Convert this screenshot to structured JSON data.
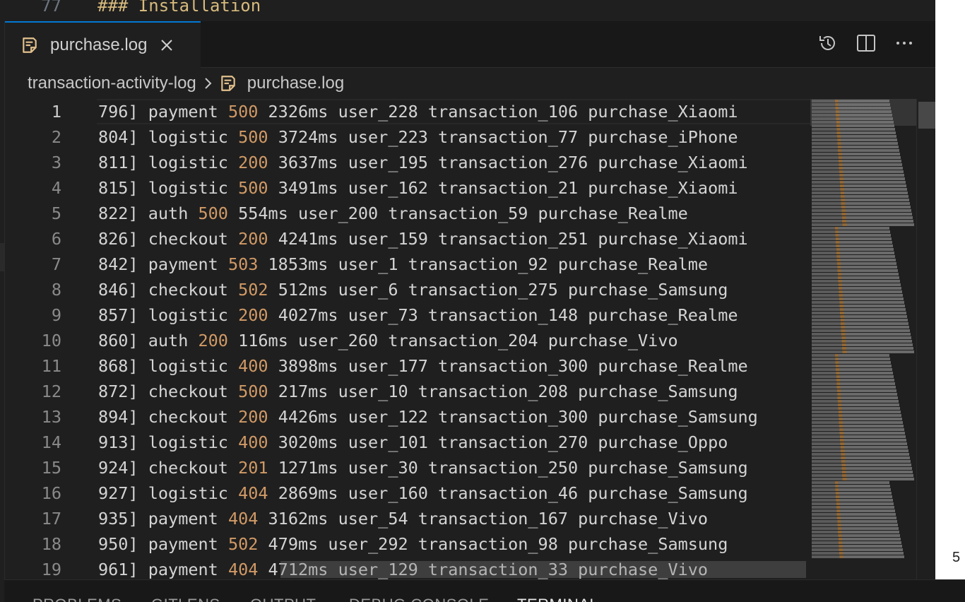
{
  "top_sliver": {
    "line_number": "77",
    "text": "### Installation"
  },
  "tab": {
    "label": "purchase.log"
  },
  "breadcrumb": {
    "folder": "transaction-activity-log",
    "file": "purchase.log"
  },
  "right_strip": {
    "digit": "5"
  },
  "lines": [
    {
      "n": "1",
      "prefix": "796] ",
      "service": "payment",
      "status": "500",
      "rest": " 2326ms user_228 transaction_106 purchase_Xiaomi"
    },
    {
      "n": "2",
      "prefix": "804] ",
      "service": "logistic",
      "status": "500",
      "rest": " 3724ms user_223 transaction_77 purchase_iPhone"
    },
    {
      "n": "3",
      "prefix": "811] ",
      "service": "logistic",
      "status": "200",
      "rest": " 3637ms user_195 transaction_276 purchase_Xiaomi"
    },
    {
      "n": "4",
      "prefix": "815] ",
      "service": "logistic",
      "status": "500",
      "rest": " 3491ms user_162 transaction_21 purchase_Xiaomi"
    },
    {
      "n": "5",
      "prefix": "822] ",
      "service": "auth",
      "status": "500",
      "rest": " 554ms user_200 transaction_59 purchase_Realme"
    },
    {
      "n": "6",
      "prefix": "826] ",
      "service": "checkout",
      "status": "200",
      "rest": " 4241ms user_159 transaction_251 purchase_Xiaomi"
    },
    {
      "n": "7",
      "prefix": "842] ",
      "service": "payment",
      "status": "503",
      "rest": " 1853ms user_1 transaction_92 purchase_Realme"
    },
    {
      "n": "8",
      "prefix": "846] ",
      "service": "checkout",
      "status": "502",
      "rest": " 512ms user_6 transaction_275 purchase_Samsung"
    },
    {
      "n": "9",
      "prefix": "857] ",
      "service": "logistic",
      "status": "200",
      "rest": " 4027ms user_73 transaction_148 purchase_Realme"
    },
    {
      "n": "10",
      "prefix": "860] ",
      "service": "auth",
      "status": "200",
      "rest": " 116ms user_260 transaction_204 purchase_Vivo"
    },
    {
      "n": "11",
      "prefix": "868] ",
      "service": "logistic",
      "status": "400",
      "rest": " 3898ms user_177 transaction_300 purchase_Realme"
    },
    {
      "n": "12",
      "prefix": "872] ",
      "service": "checkout",
      "status": "500",
      "rest": " 217ms user_10 transaction_208 purchase_Samsung"
    },
    {
      "n": "13",
      "prefix": "894] ",
      "service": "checkout",
      "status": "200",
      "rest": " 4426ms user_122 transaction_300 purchase_Samsung"
    },
    {
      "n": "14",
      "prefix": "913] ",
      "service": "logistic",
      "status": "400",
      "rest": " 3020ms user_101 transaction_270 purchase_Oppo"
    },
    {
      "n": "15",
      "prefix": "924] ",
      "service": "checkout",
      "status": "201",
      "rest": " 1271ms user_30 transaction_250 purchase_Samsung"
    },
    {
      "n": "16",
      "prefix": "927] ",
      "service": "logistic",
      "status": "404",
      "rest": " 2869ms user_160 transaction_46 purchase_Samsung"
    },
    {
      "n": "17",
      "prefix": "935] ",
      "service": "payment",
      "status": "404",
      "rest": " 3162ms user_54 transaction_167 purchase_Vivo"
    },
    {
      "n": "18",
      "prefix": "950] ",
      "service": "payment",
      "status": "502",
      "rest": " 479ms user_292 transaction_98 purchase_Samsung"
    },
    {
      "n": "19",
      "prefix": "961] ",
      "service": "payment",
      "status": "404",
      "rest": " 4712ms user_129 transaction_33 purchase_Vivo"
    }
  ],
  "panel_tabs": [
    "PROBLEMS",
    "GITLENS",
    "OUTPUT",
    "DEBUG CONSOLE",
    "TERMINAL"
  ],
  "icons": {
    "file": "file-text-icon",
    "close": "close-icon",
    "history": "history-icon",
    "split": "split-editor-icon",
    "more": "more-actions-icon",
    "chevron": "chevron-right-icon"
  },
  "colors": {
    "status": "#d19a66",
    "accent": "#0078d4",
    "file_icon": "#e2c08d"
  }
}
